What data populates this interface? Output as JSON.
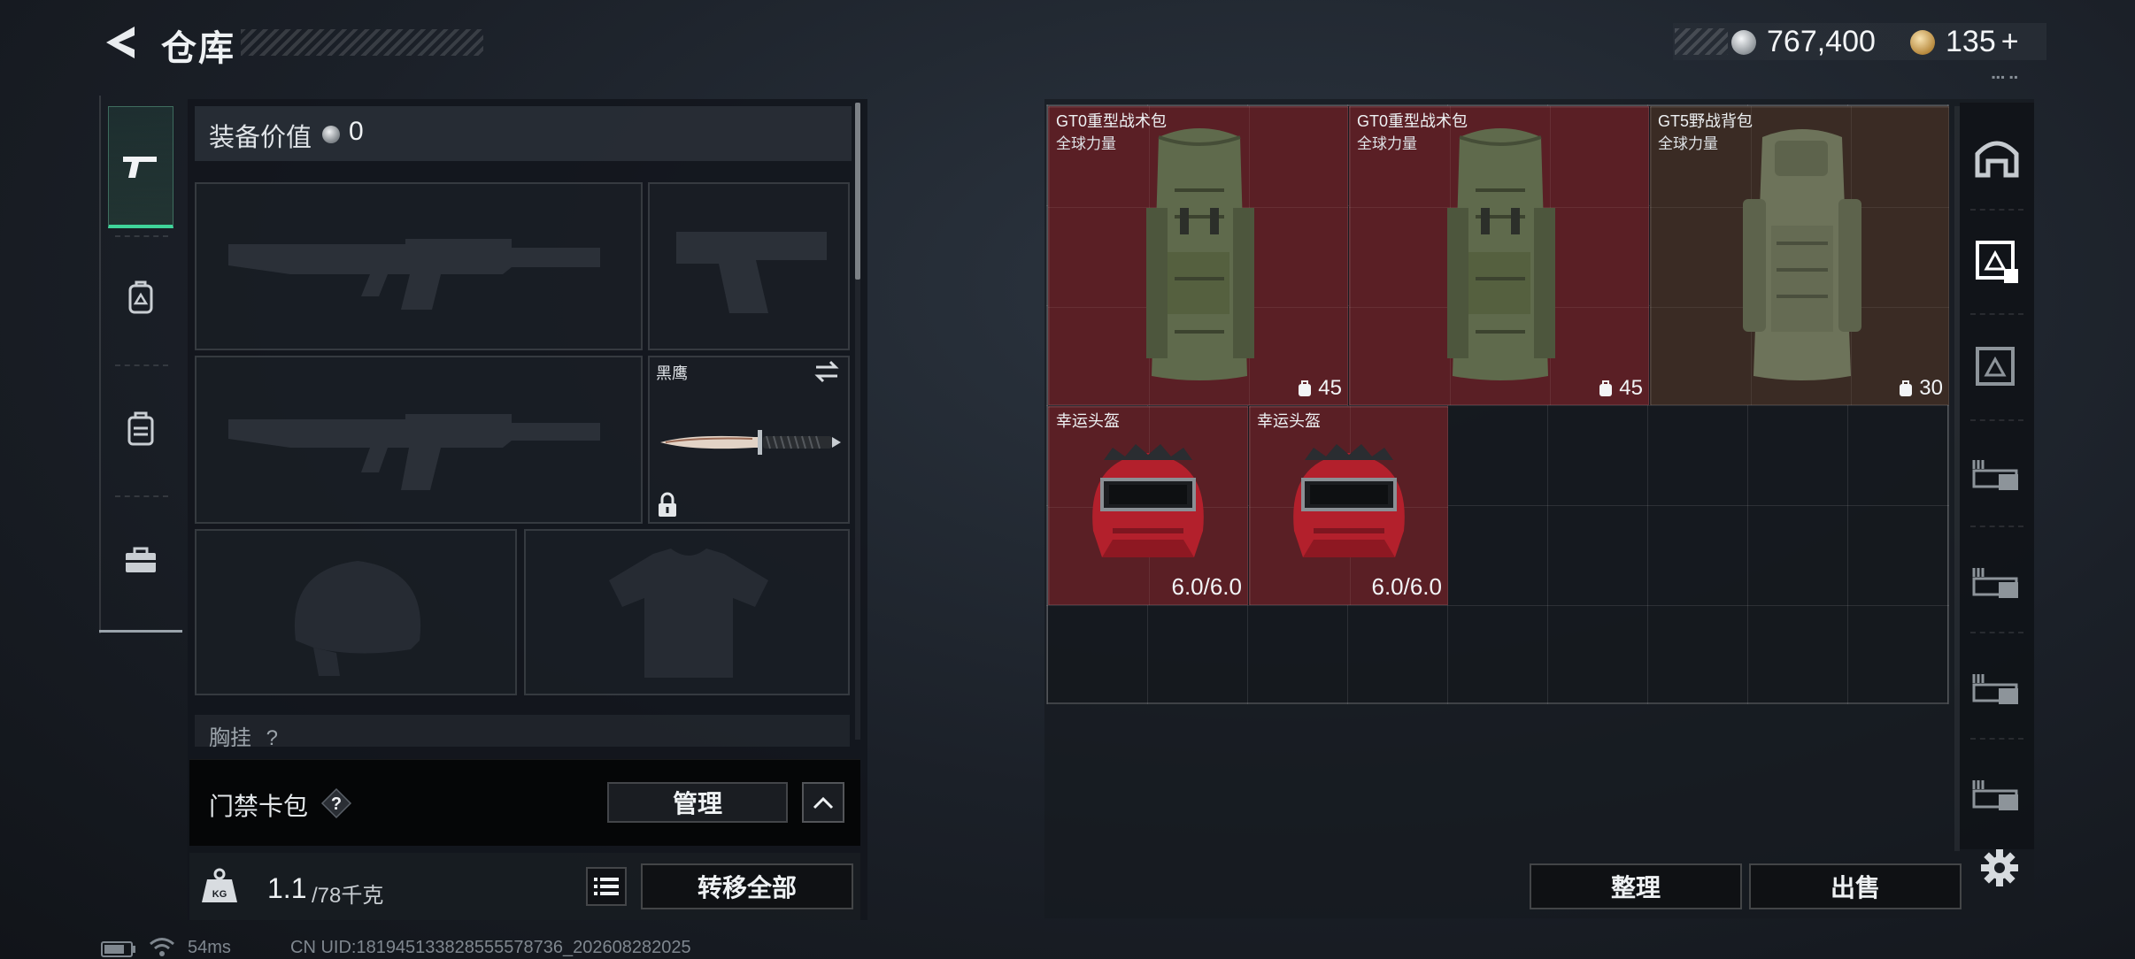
{
  "header": {
    "title": "仓库",
    "silver_coins": "767,400",
    "gold_coins": "135",
    "gold_plus": "+"
  },
  "left_tabs": [
    {
      "icon": "pistol-icon",
      "active": true
    },
    {
      "icon": "backpack-helmet-icon",
      "active": false
    },
    {
      "icon": "backpack-icon",
      "active": false
    },
    {
      "icon": "toolbox-icon",
      "active": false
    }
  ],
  "equipment": {
    "value_label": "装备价值",
    "value_amount": "0",
    "melee_name": "黑鹰",
    "vest_label": "胸挂",
    "vest_help": "?"
  },
  "keycard": {
    "label": "门禁卡包",
    "help": "?",
    "manage_label": "管理"
  },
  "footer": {
    "weight_current": "1.1",
    "weight_max": "/78千克",
    "transfer_all_label": "转移全部"
  },
  "items": [
    {
      "name": "GT0重型战术包",
      "sub": "全球力量",
      "capacity": "45",
      "rarity": "red"
    },
    {
      "name": "GT0重型战术包",
      "sub": "全球力量",
      "capacity": "45",
      "rarity": "red"
    },
    {
      "name": "GT5野战背包",
      "sub": "全球力量",
      "capacity": "30",
      "rarity": "brown"
    },
    {
      "name": "幸运头盔",
      "durability": "6.0/6.0",
      "rarity": "red"
    },
    {
      "name": "幸运头盔",
      "durability": "6.0/6.0",
      "rarity": "red"
    }
  ],
  "right_actions": {
    "sort_label": "整理",
    "sell_label": "出售"
  },
  "status_bar": {
    "ping": "54ms",
    "uid": "CN UID:181945133828555578736_202608282025"
  },
  "colors": {
    "accent_green": "#3fd49a",
    "rarity_red": "#5a1f25",
    "rarity_brown": "#3a2b24"
  }
}
